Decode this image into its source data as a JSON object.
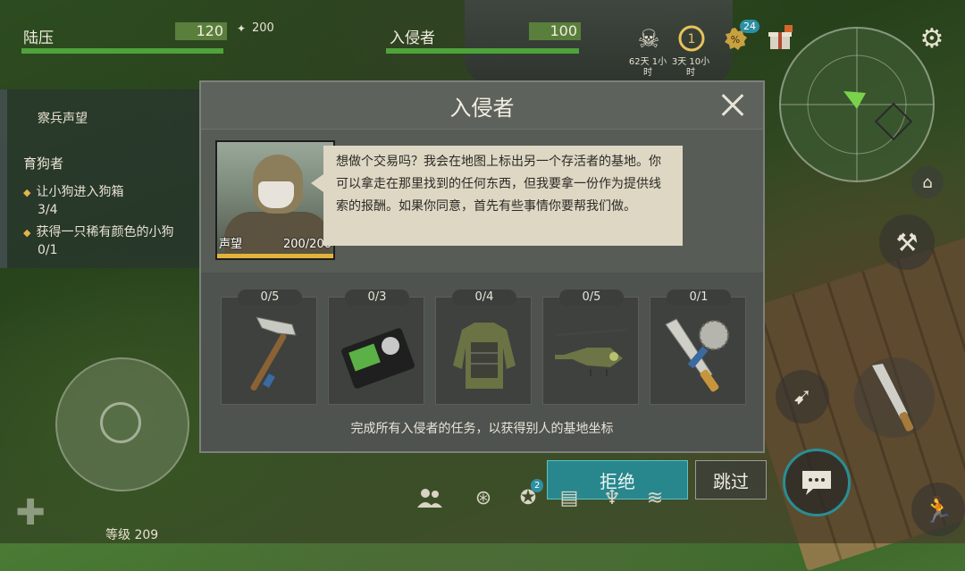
{
  "hud": {
    "player_name": "陆压",
    "player_hp": "120",
    "player_hp_fraction": 1.0,
    "ammo_count": "200",
    "enemy_name": "入侵者",
    "enemy_hp": "100",
    "enemy_hp_fraction": 1.0,
    "timer1": "62天 1小时",
    "timer2": "3天 10小时",
    "badge_count": "24",
    "level_label": "等级 209"
  },
  "quests": {
    "partial_line": "察兵声望",
    "section_title": "育狗者",
    "items": [
      {
        "text": "让小狗进入狗箱",
        "progress": "3/4"
      },
      {
        "text": "获得一只稀有颜色的小狗",
        "progress": "0/1"
      }
    ]
  },
  "modal": {
    "title": "入侵者",
    "portrait_label": "声望",
    "portrait_value": "200/200",
    "dialogue": "想做个交易吗？我会在地图上标出另一个存活者的基地。你可以拿走在那里找到的任何东西，但我要拿一份作为提供线索的报酬。如果你同意，首先有些事情你要帮我们做。",
    "tasks": [
      {
        "progress": "0/5",
        "icon": "hammer-icon"
      },
      {
        "progress": "0/3",
        "icon": "police-badge-icon"
      },
      {
        "progress": "0/4",
        "icon": "armor-vest-icon"
      },
      {
        "progress": "0/5",
        "icon": "helicopter-icon"
      },
      {
        "progress": "0/1",
        "icon": "saw-machete-icon"
      }
    ],
    "note": "完成所有入侵者的任务，以获得别人的基地坐标",
    "decline_label": "拒绝",
    "skip_label": "跳过"
  },
  "bottom_bar": {
    "notification_count": "2"
  },
  "colors": {
    "modal_bg": "#4f534f",
    "accent_teal": "#2a8e93",
    "hp_green": "#4fa33b",
    "reputation_gold": "#e2b43a"
  }
}
